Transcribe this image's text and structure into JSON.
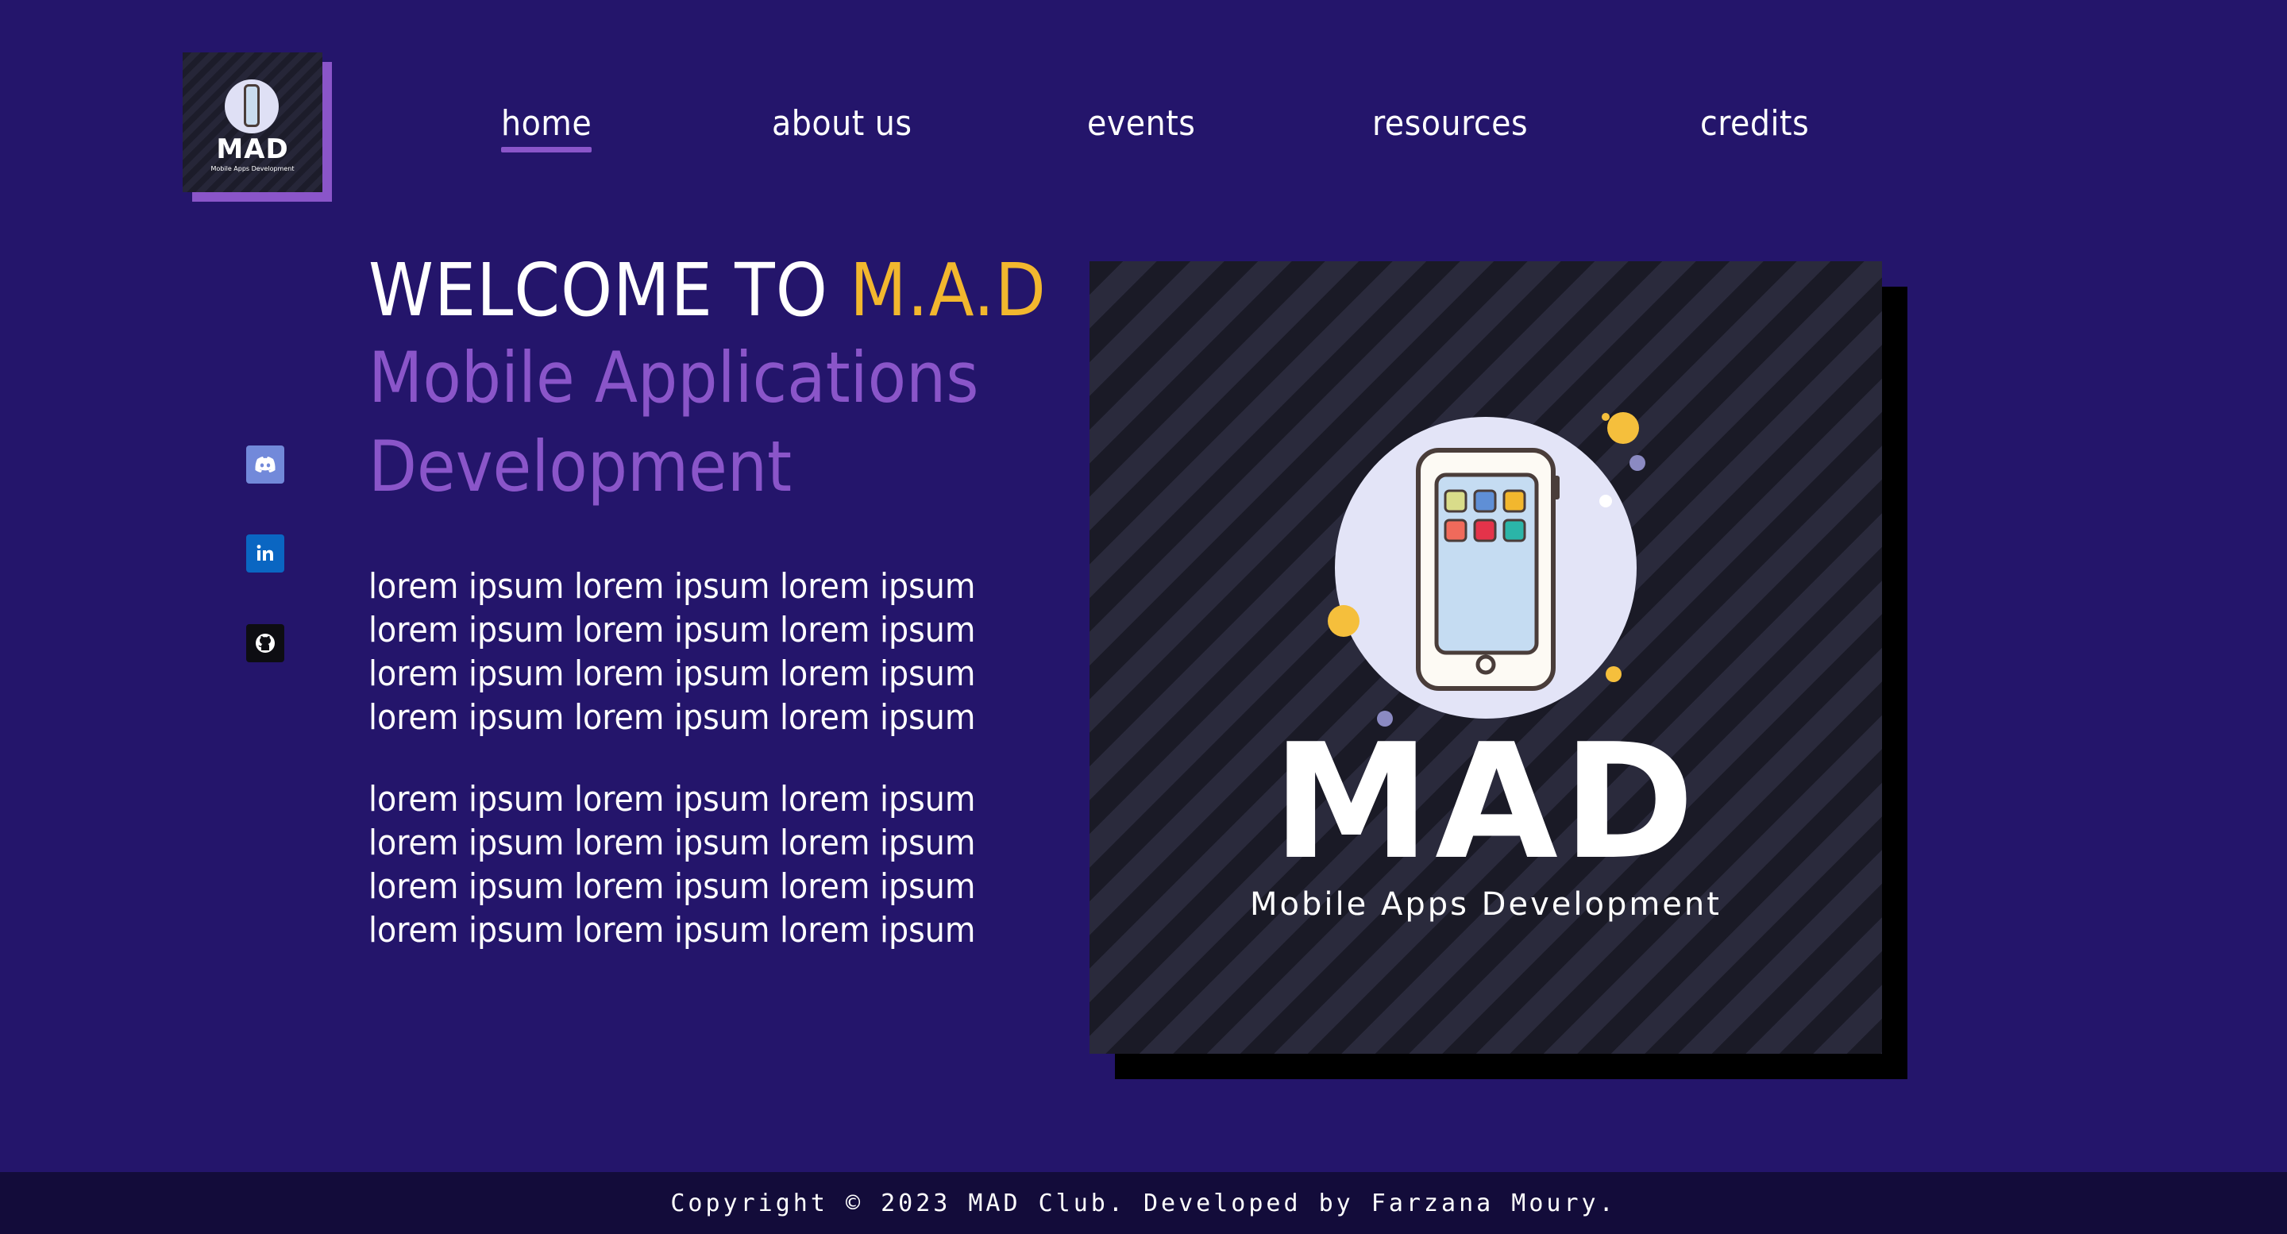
{
  "logo": {
    "title": "MAD",
    "subtitle": "Mobile Apps Development"
  },
  "nav": {
    "items": [
      {
        "label": "home",
        "active": true
      },
      {
        "label": "about us",
        "active": false
      },
      {
        "label": "events",
        "active": false
      },
      {
        "label": "resources",
        "active": false
      },
      {
        "label": "credits",
        "active": false
      }
    ]
  },
  "social": [
    {
      "icon": "discord-icon",
      "color": "#7289da"
    },
    {
      "icon": "linkedin-icon",
      "color": "#0a66c2"
    },
    {
      "icon": "github-icon",
      "color": "#0d0d12"
    }
  ],
  "hero": {
    "welcome_prefix": "WELCOME TO ",
    "welcome_brand": "M.A.D",
    "subtitle_line1": "Mobile Applications",
    "subtitle_line2": "Development",
    "paragraph1": "lorem ipsum lorem ipsum lorem ipsum lorem ipsum lorem ipsum lorem ipsum lorem ipsum lorem ipsum lorem ipsum lorem ipsum lorem ipsum lorem ipsum",
    "paragraph2": "lorem ipsum lorem ipsum lorem ipsum lorem ipsum lorem ipsum lorem ipsum lorem ipsum lorem ipsum lorem ipsum lorem ipsum lorem ipsum lorem ipsum",
    "image_title": "MAD",
    "image_subtitle": "Mobile Apps Development"
  },
  "footer": {
    "text": "Copyright © 2023 MAD Club. Developed by Farzana Moury."
  },
  "colors": {
    "background": "#24156b",
    "accent_purple": "#8a55c9",
    "accent_yellow": "#f2b72e",
    "footer_bg": "#130c3a"
  }
}
